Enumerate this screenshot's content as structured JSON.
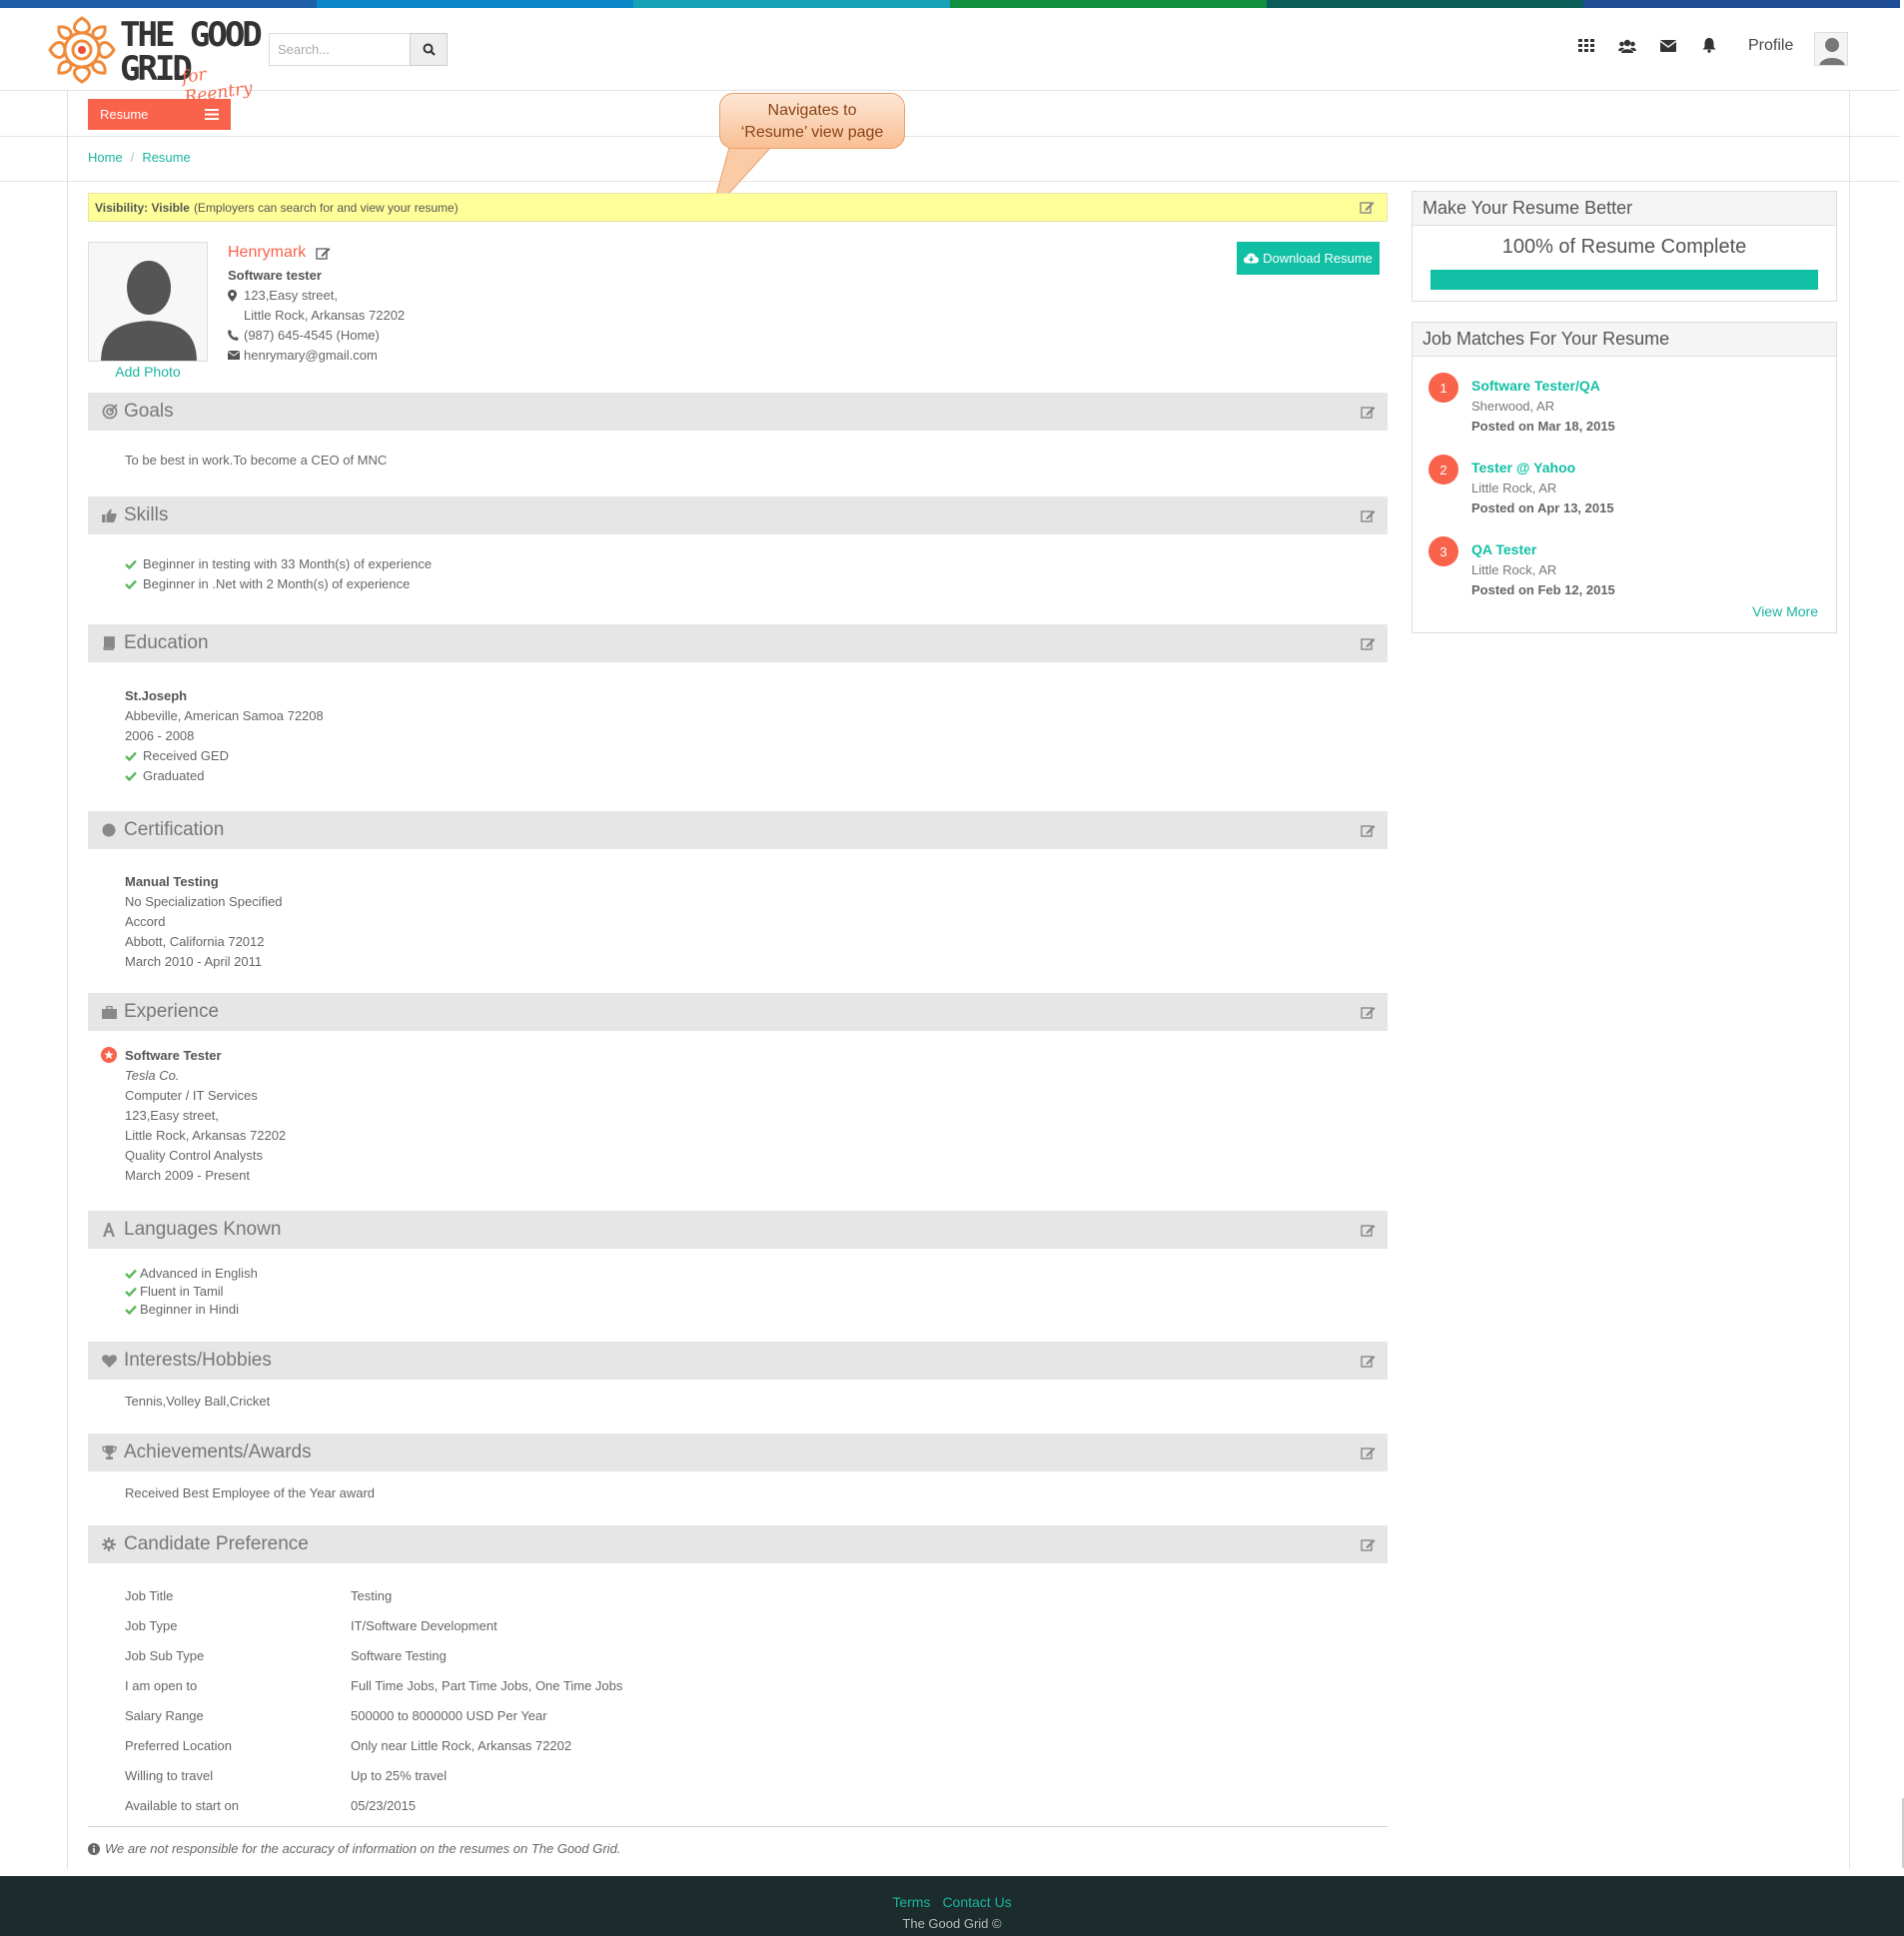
{
  "header": {
    "logo_line1": "THE GOOD",
    "logo_line2": "GRID",
    "logo_sub": "for Reentry",
    "search_placeholder": "Search...",
    "profile_label": "Profile",
    "stripe_colors": [
      "#1e5fa8",
      "#0a87c9",
      "#15a2b7",
      "#0f8f3f",
      "#0a5d59",
      "#1f4e96"
    ]
  },
  "subnav": {
    "resume_tab": "Resume"
  },
  "callout": {
    "line1": "Navigates to",
    "line2": "‘Resume’ view page"
  },
  "breadcrumb": {
    "home": "Home",
    "sep": "/",
    "current": "Resume"
  },
  "visibility": {
    "label": "Visibility: Visible",
    "note": "(Employers can search for and view your resume)"
  },
  "profile": {
    "name": "Henrymark",
    "title": "Software tester",
    "address1": "123,Easy street,",
    "address2": "Little Rock, Arkansas  72202",
    "phone": "(987) 645-4545 (Home)",
    "email": "henrymary@gmail.com",
    "add_photo": "Add Photo",
    "download_label": "Download Resume"
  },
  "sections": {
    "goals": {
      "title": "Goals",
      "text": "To be best in work.To become a CEO of MNC"
    },
    "skills": {
      "title": "Skills",
      "items": [
        "Beginner in testing with 33  Month(s) of experience",
        "Beginner in .Net with 2  Month(s) of experience"
      ]
    },
    "education": {
      "title": "Education",
      "school": "St.Joseph",
      "location": "Abbeville, American Samoa  72208",
      "years": "2006 - 2008",
      "items": [
        "Received GED",
        "Graduated"
      ]
    },
    "certification": {
      "title": "Certification",
      "name": "Manual Testing",
      "specialization": "No Specialization Specified",
      "issuer": "Accord",
      "location": "Abbott, California  72012",
      "dates": "March 2010 - April 2011"
    },
    "experience": {
      "title": "Experience",
      "role": "Software Tester",
      "company": "Tesla Co.",
      "industry": "Computer / IT Services",
      "address1": "123,Easy street,",
      "address2": "Little Rock, Arkansas  72202",
      "department": "Quality Control Analysts",
      "dates": "March 2009 - Present"
    },
    "languages": {
      "title": "Languages Known",
      "items": [
        "Advanced in English",
        "Fluent in Tamil",
        "Beginner in Hindi"
      ]
    },
    "interests": {
      "title": "Interests/Hobbies",
      "text": "Tennis,Volley Ball,Cricket"
    },
    "achievements": {
      "title": "Achievements/Awards",
      "text": "Received Best Employee of the Year award"
    },
    "preference": {
      "title": "Candidate Preference",
      "rows": [
        {
          "label": "Job Title",
          "value": "Testing"
        },
        {
          "label": "Job Type",
          "value": "IT/Software Development"
        },
        {
          "label": "Job Sub Type",
          "value": "Software Testing"
        },
        {
          "label": "I am open to",
          "value": "Full Time Jobs, Part Time Jobs, One Time Jobs"
        },
        {
          "label": "Salary Range",
          "value": "500000 to 8000000 USD Per Year"
        },
        {
          "label": "Preferred Location",
          "value": "Only near Little Rock, Arkansas 72202"
        },
        {
          "label": "Willing to travel",
          "value": "Up to 25% travel"
        },
        {
          "label": "Available to start on",
          "value": "05/23/2015"
        }
      ]
    }
  },
  "disclaimer": "We are not responsible for the accuracy of information on the resumes on The Good Grid.",
  "sidebar": {
    "better_title": "Make Your Resume Better",
    "complete_label": "100% of Resume Complete",
    "complete_fraction": 1.0,
    "matches_title": "Job Matches For Your Resume",
    "matches": [
      {
        "num": "1",
        "title": "Software Tester/QA",
        "location": "Sherwood, AR",
        "posted": "Posted on Mar 18, 2015"
      },
      {
        "num": "2",
        "title": "Tester @ Yahoo",
        "location": "Little Rock, AR",
        "posted": "Posted on Apr 13, 2015"
      },
      {
        "num": "3",
        "title": "QA Tester",
        "location": "Little Rock, AR",
        "posted": "Posted on Feb 12, 2015"
      }
    ],
    "view_more": "View More"
  },
  "footer": {
    "terms": "Terms",
    "contact": "Contact Us",
    "copyright": "The Good Grid ©"
  },
  "colors": {
    "accent_orange": "#f9624b",
    "accent_teal": "#11bfa5",
    "footer_bg": "#1c2b2b"
  }
}
